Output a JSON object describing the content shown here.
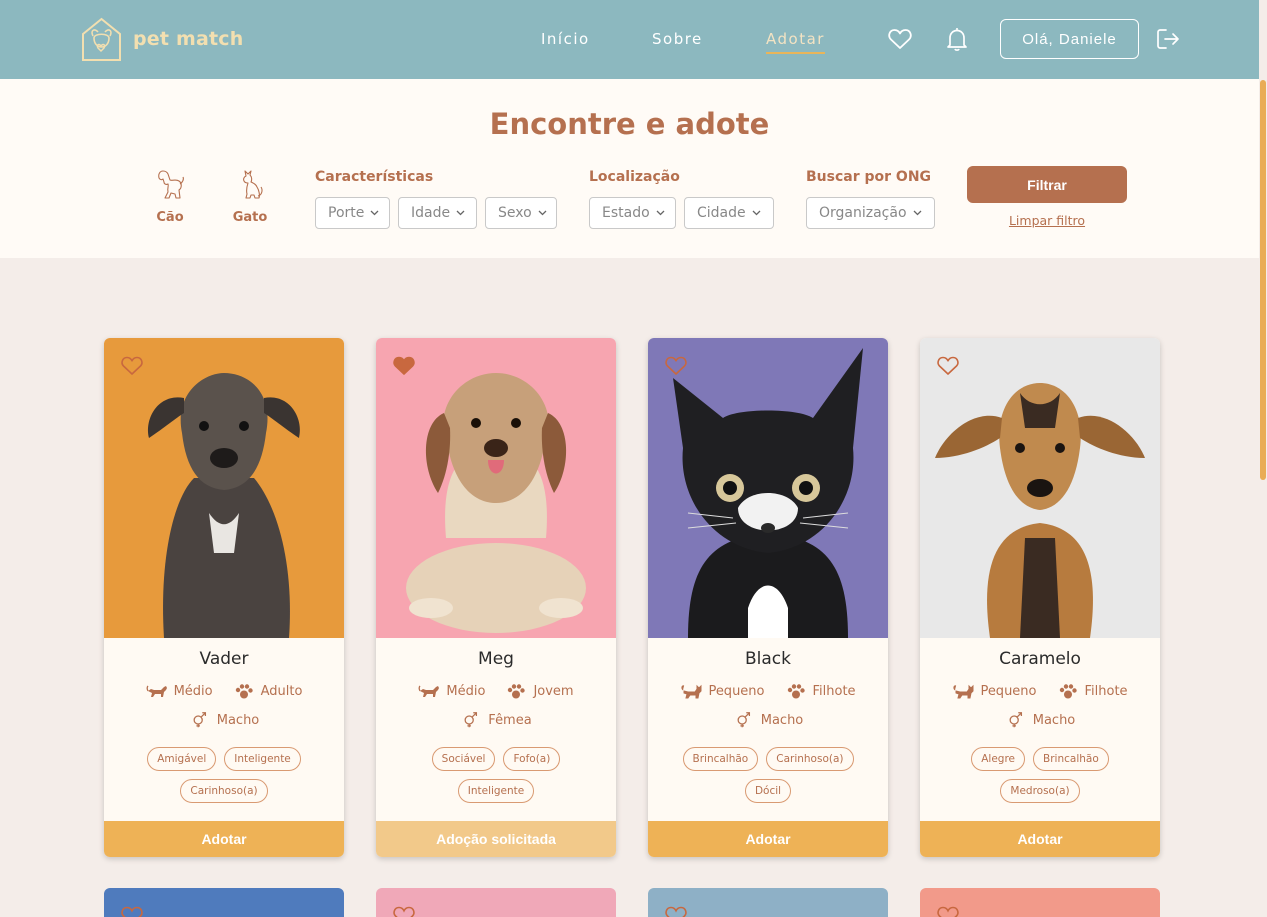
{
  "header": {
    "brand": "pet match",
    "nav": [
      {
        "label": "Início",
        "active": false
      },
      {
        "label": "Sobre",
        "active": false
      },
      {
        "label": "Adotar",
        "active": true
      }
    ],
    "greeting": "Olá, Daniele",
    "icons": [
      "heart-icon",
      "bell-icon",
      "logout-icon"
    ]
  },
  "filters": {
    "title": "Encontre e adote",
    "species": [
      {
        "label": "Cão",
        "icon": "dog-icon"
      },
      {
        "label": "Gato",
        "icon": "cat-icon"
      }
    ],
    "groups": {
      "characteristics": {
        "label": "Características",
        "options": [
          "Porte",
          "Idade",
          "Sexo"
        ]
      },
      "location": {
        "label": "Localização",
        "options": [
          "Estado",
          "Cidade"
        ]
      },
      "ong": {
        "label": "Buscar por ONG",
        "options": [
          "Organização"
        ]
      }
    },
    "filter_button": "Filtrar",
    "clear_link": "Limpar filtro"
  },
  "pets": [
    {
      "name": "Vader",
      "size": "Médio",
      "age": "Adulto",
      "sex": "Macho",
      "favorite": false,
      "tags_row1": [
        "Amigável",
        "Inteligente"
      ],
      "tags_row2": [
        "Carinhoso(a)"
      ],
      "action": "Adotar",
      "requested": false,
      "bg": "#e79a3c"
    },
    {
      "name": "Meg",
      "size": "Médio",
      "age": "Jovem",
      "sex": "Fêmea",
      "favorite": true,
      "tags_row1": [
        "Sociável",
        "Fofo(a)"
      ],
      "tags_row2": [
        "Inteligente"
      ],
      "action": "Adoção solicitada",
      "requested": true,
      "bg": "#f7a5b0"
    },
    {
      "name": "Black",
      "size": "Pequeno",
      "age": "Filhote",
      "sex": "Macho",
      "favorite": false,
      "tags_row1": [
        "Brincalhão",
        "Carinhoso(a)"
      ],
      "tags_row2": [
        "Dócil"
      ],
      "action": "Adotar",
      "requested": false,
      "bg": "#7f78b7"
    },
    {
      "name": "Caramelo",
      "size": "Pequeno",
      "age": "Filhote",
      "sex": "Macho",
      "favorite": false,
      "tags_row1": [
        "Alegre",
        "Brincalhão"
      ],
      "tags_row2": [
        "Medroso(a)"
      ],
      "action": "Adotar",
      "requested": false,
      "bg": "#e8e8e8"
    }
  ],
  "next_row_colors": [
    "#4f7bbd",
    "#f0a8b8",
    "#8eb0c6",
    "#f29a8a"
  ],
  "colors": {
    "header": "#8cb8bf",
    "accent": "#b5704f",
    "adopt": "#eeb256",
    "requested": "#f2c98a"
  }
}
